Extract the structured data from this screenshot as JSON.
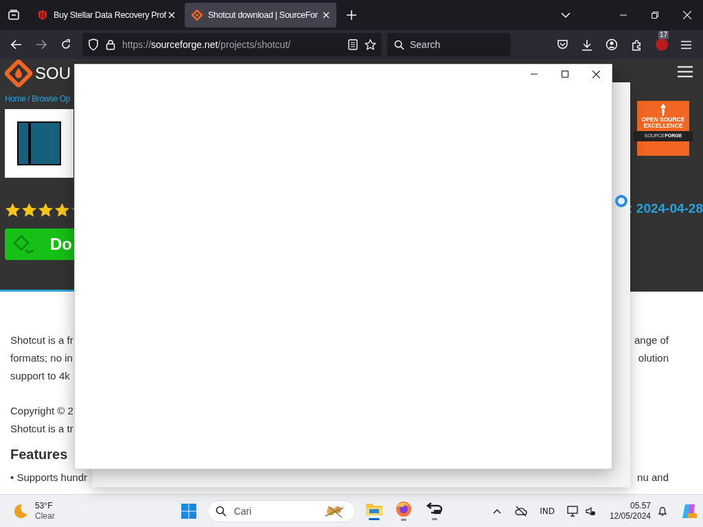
{
  "browser": {
    "tabs": [
      {
        "title": "Buy Stellar Data Recovery Prof",
        "selected": false,
        "kind": "stellar"
      },
      {
        "title": "Shotcut download | SourceFor",
        "selected": true,
        "kind": "sourceforge"
      }
    ],
    "url_host": "sourceforge.net",
    "url_prefix": "https://",
    "url_path": "/projects/shotcut/",
    "search": {
      "placeholder": "Search"
    },
    "extension_badge": "17"
  },
  "page": {
    "logo_text": "SOU",
    "breadcrumb": "Home / Browse Op",
    "stars": 4,
    "download_label": "Do",
    "updated": ": 2024-04-28",
    "award": {
      "line_1": "OPEN SOURCE",
      "line_2": "EXCELLENCE",
      "brand_1": "SOURCE",
      "brand_2": "FORGE"
    },
    "description_left": [
      "Shotcut is a fr",
      "formats; no in",
      "support to 4k"
    ],
    "description_right": [
      "ange of",
      "olution"
    ],
    "copyright_left": [
      "Copyright © 2",
      "Shotcut is a tr"
    ],
    "features_heading": "Features",
    "feature_left": "• Supports hundr",
    "feature_right": "nu and"
  },
  "dialog": {
    "loading": true
  },
  "taskbar": {
    "weather": {
      "temp": "53°F",
      "condition": "Clear"
    },
    "search": {
      "placeholder": "Cari"
    },
    "language": "IND",
    "time": "05.57",
    "date": "12/05/2024"
  }
}
